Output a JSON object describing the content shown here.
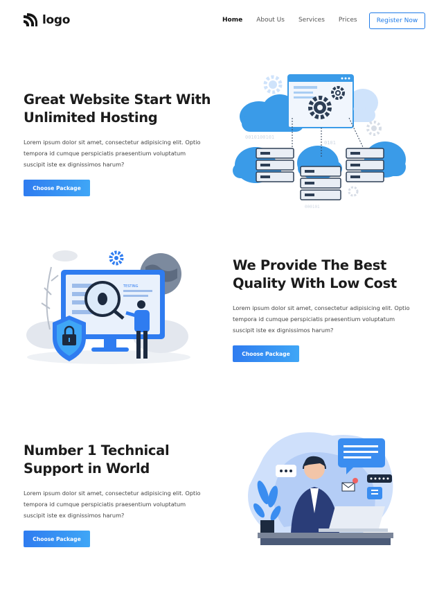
{
  "header": {
    "logo_text": "logo",
    "nav": [
      {
        "label": "Home",
        "active": true
      },
      {
        "label": "About Us",
        "active": false
      },
      {
        "label": "Services",
        "active": false
      },
      {
        "label": "Prices",
        "active": false
      }
    ],
    "register_label": "Register Now"
  },
  "sections": [
    {
      "title_line1": "Great Website Start With",
      "title_line2": "Unlimited Hosting",
      "desc_line1": "Lorem ipsum dolor sit amet, consectetur adipisicing elit. Optio",
      "desc_line2": "tempora id cumque perspiciatis praesentium voluptatum",
      "desc_line3": "suscipit iste ex dignissimos harum?",
      "button_label": "Choose Package"
    },
    {
      "title_line1": "We Provide The Best",
      "title_line2": "Quality With Low Cost",
      "desc_line1": "Lorem ipsum dolor sit amet, consectetur adipisicing elit. Optio",
      "desc_line2": "tempora id cumque perspiciatis praesentium voluptatum",
      "desc_line3": "suscipit iste ex dignissimos harum?",
      "button_label": "Choose Package"
    },
    {
      "title_line1": "Number 1 Technical",
      "title_line2": "Support in World",
      "desc_line1": "Lorem ipsum dolor sit amet, consectetur adipisicing elit. Optio",
      "desc_line2": "tempora id cumque perspiciatis praesentium voluptatum",
      "desc_line3": "suscipit iste ex dignissimos harum?",
      "button_label": "Choose Package"
    }
  ],
  "illustrations": {
    "hosting_binary_a": "0101",
    "hosting_binary_b": "0010100101",
    "hosting_binary_c": "0101",
    "hosting_binary_d": "000101",
    "testing_label": "TESTING"
  },
  "colors": {
    "accent": "#1f7be8",
    "button_gradient_start": "#2f7cf0",
    "button_gradient_end": "#3fa6f6",
    "illustration_blue": "#3a9be8",
    "illustration_light": "#cfe3fb"
  }
}
